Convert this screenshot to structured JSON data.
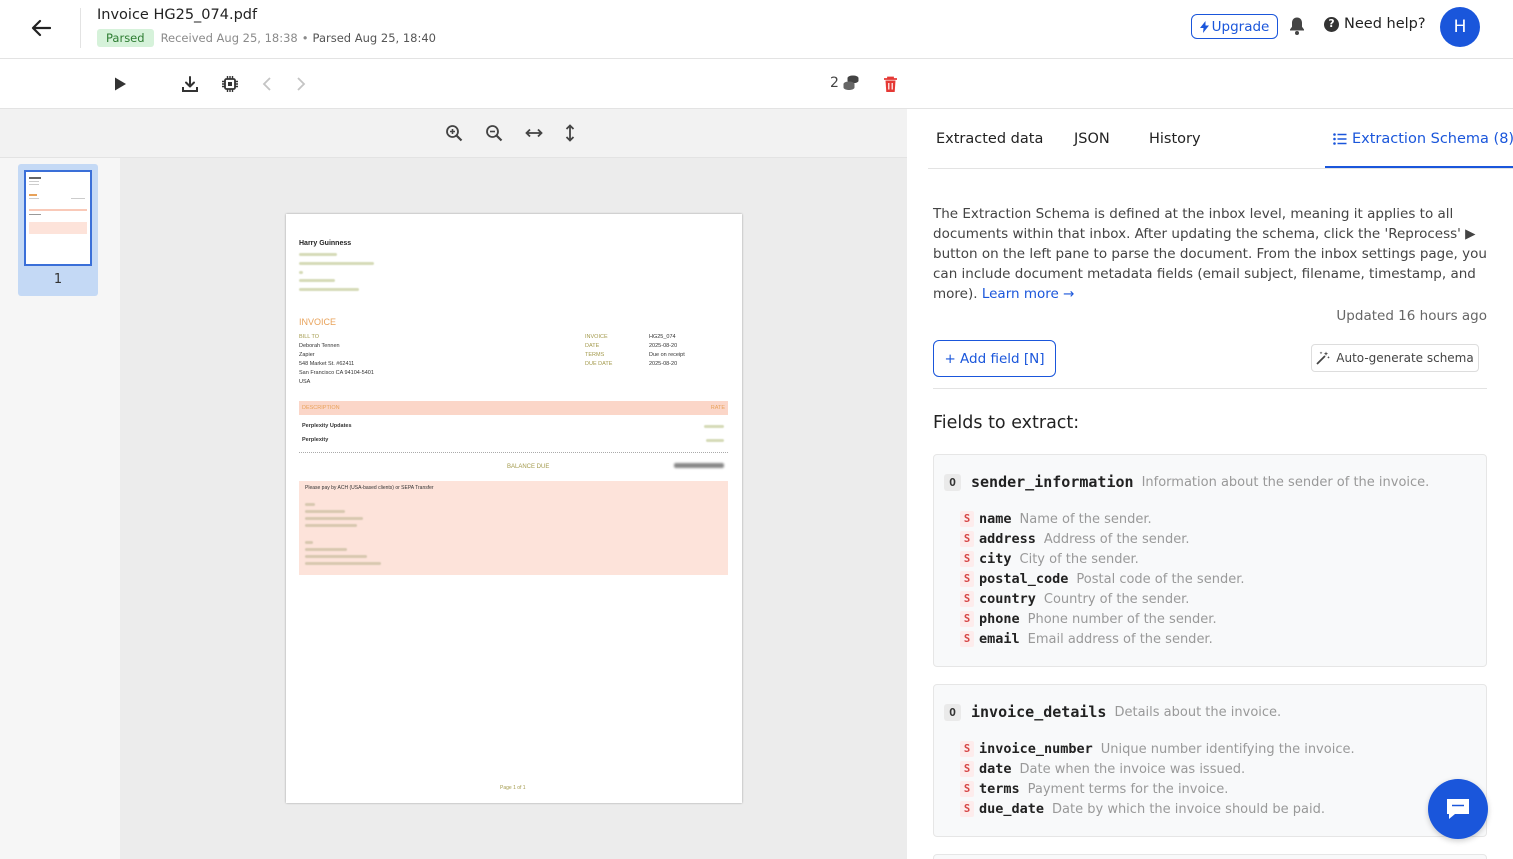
{
  "header": {
    "title": "Invoice HG25_074.pdf",
    "status_badge": "Parsed",
    "received": "Received Aug 25, 18:38",
    "separator": "•",
    "parsed_at": "Parsed Aug 25, 18:40",
    "upgrade_label": "Upgrade",
    "help_label": "Need help?",
    "avatar_initial": "H"
  },
  "toolbar": {
    "credits": "2"
  },
  "thumbnails": [
    {
      "page_number": "1"
    }
  ],
  "document": {
    "sender_name": "Harry Guinness",
    "invoice_heading": "INVOICE",
    "bill_to_label": "BILL TO",
    "bill_to_lines": [
      "Deborah Tennen",
      "Zapier",
      "548 Market St. #62411",
      "San Francisco  CA 94104-5401",
      "USA"
    ],
    "meta_labels": [
      "INVOICE",
      "DATE",
      "TERMS",
      "DUE DATE"
    ],
    "meta_values": [
      "HG25_074",
      "2025-08-20",
      "Due on receipt",
      "2025-08-20"
    ],
    "col_description": "DESCRIPTION",
    "col_rate": "RATE",
    "line_items": [
      "Perplexity Updates",
      "Perplexity"
    ],
    "balance_due_label": "BALANCE DUE",
    "payment_note": "Please pay by ACH (USA-based clients) or SEPA Transfer",
    "footer": "Page 1 of 1"
  },
  "tabs": [
    {
      "label": "Extracted data"
    },
    {
      "label": "JSON"
    },
    {
      "label": "History"
    },
    {
      "label": "Extraction Schema (8)"
    }
  ],
  "schema": {
    "description": "The Extraction Schema is defined at the inbox level, meaning it applies to all documents within that inbox. After updating the schema, click the 'Reprocess' ▶ button on the left pane to parse the document. From the inbox settings page, you can include document metadata fields (email subject, filename, timestamp, and more).",
    "learn_more": "Learn more →",
    "updated": "Updated 16 hours ago",
    "add_field_label": "+ Add field [N]",
    "autogen_label": "Auto-generate schema",
    "fields_title": "Fields to extract:",
    "objects": [
      {
        "type": "O",
        "name": "sender_information",
        "description": "Information about the sender of the invoice.",
        "fields": [
          {
            "type": "S",
            "name": "name",
            "description": "Name of the sender."
          },
          {
            "type": "S",
            "name": "address",
            "description": "Address of the sender."
          },
          {
            "type": "S",
            "name": "city",
            "description": "City of the sender."
          },
          {
            "type": "S",
            "name": "postal_code",
            "description": "Postal code of the sender."
          },
          {
            "type": "S",
            "name": "country",
            "description": "Country of the sender."
          },
          {
            "type": "S",
            "name": "phone",
            "description": "Phone number of the sender."
          },
          {
            "type": "S",
            "name": "email",
            "description": "Email address of the sender."
          }
        ]
      },
      {
        "type": "O",
        "name": "invoice_details",
        "description": "Details about the invoice.",
        "fields": [
          {
            "type": "S",
            "name": "invoice_number",
            "description": "Unique number identifying the invoice."
          },
          {
            "type": "S",
            "name": "date",
            "description": "Date when the invoice was issued."
          },
          {
            "type": "S",
            "name": "terms",
            "description": "Payment terms for the invoice."
          },
          {
            "type": "S",
            "name": "due_date",
            "description": "Date by which the invoice should be paid."
          }
        ]
      }
    ]
  },
  "colors": {
    "accent": "#1a56db",
    "parsed_badge_bg": "#d6f2da",
    "parsed_badge_text": "#2e7d32",
    "delete_icon": "#e53935",
    "invoice_orange": "#e8a25a",
    "table_header_bg": "#fde3da"
  },
  "icons": [
    "back-arrow-icon",
    "bolt-icon",
    "bell-icon",
    "question-icon",
    "play-icon",
    "download-icon",
    "chip-icon",
    "chevron-left-icon",
    "chevron-right-icon",
    "coins-icon",
    "trash-icon",
    "zoom-in-icon",
    "zoom-out-icon",
    "fit-width-icon",
    "fit-height-icon",
    "list-icon",
    "magic-wand-icon",
    "chat-icon"
  ]
}
